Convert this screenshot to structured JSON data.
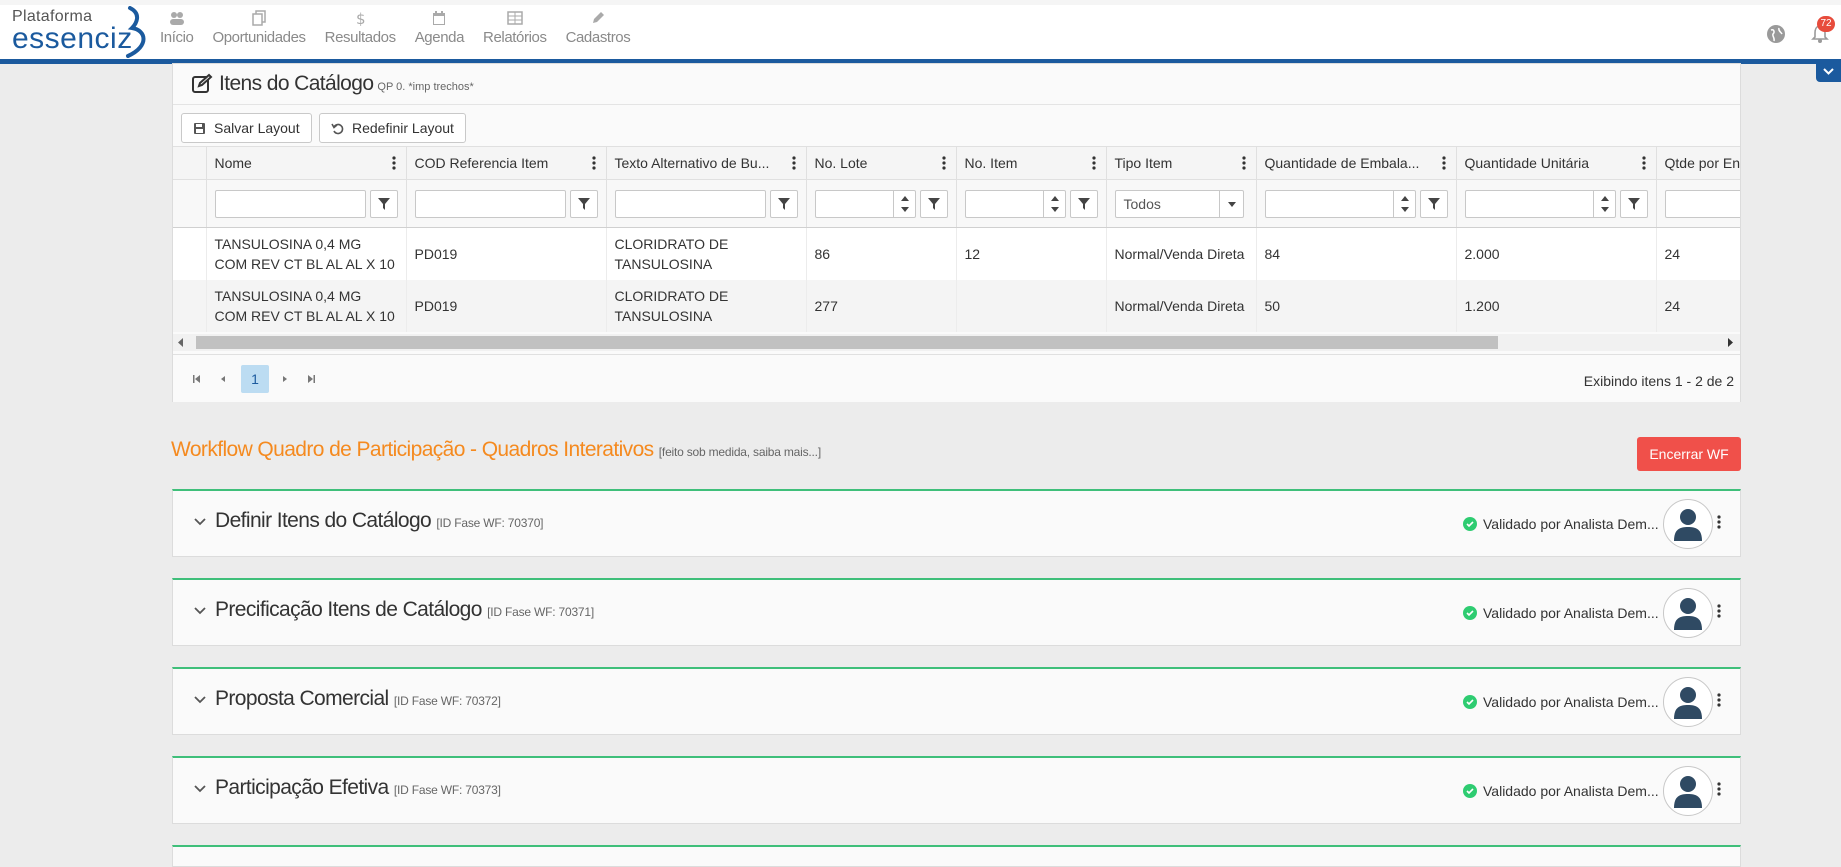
{
  "brand": {
    "line1": "Plataforma",
    "line2": "essenciz"
  },
  "nav": [
    {
      "label": "Início",
      "icon": "groups-icon"
    },
    {
      "label": "Oportunidades",
      "icon": "copy-icon"
    },
    {
      "label": "Resultados",
      "icon": "dollar-icon"
    },
    {
      "label": "Agenda",
      "icon": "calendar-icon"
    },
    {
      "label": "Relatórios",
      "icon": "table-icon"
    },
    {
      "label": "Cadastros",
      "icon": "pencil-icon"
    }
  ],
  "notifications": {
    "count": "72"
  },
  "catalog": {
    "title": "Itens do Catálogo",
    "subtitle": "QP 0. *imp trechos*",
    "save_layout": "Salvar Layout",
    "reset_layout": "Redefinir Layout",
    "columns": [
      "Nome",
      "COD Referencia Item",
      "Texto Alternativo de Bu...",
      "No. Lote",
      "No. Item",
      "Tipo Item",
      "Quantidade de Embala...",
      "Quantidade Unitária",
      "Qtde por En"
    ],
    "filter_select": "Todos",
    "rows": [
      {
        "nome": "TANSULOSINA 0,4 MG COM REV CT BL AL AL X 10",
        "cod": "PD019",
        "texto": "CLORIDRATO DE TANSULOSINA",
        "lote": "86",
        "item": "12",
        "tipo": "Normal/Venda Direta",
        "qtd_emb": "84",
        "qtd_unit": "2.000",
        "qtde_en": "24"
      },
      {
        "nome": "TANSULOSINA 0,4 MG COM REV CT BL AL AL X 10",
        "cod": "PD019",
        "texto": "CLORIDRATO DE TANSULOSINA",
        "lote": "277",
        "item": "",
        "tipo": "Normal/Venda Direta",
        "qtd_emb": "50",
        "qtd_unit": "1.200",
        "qtde_en": "24"
      }
    ],
    "pager": {
      "current": "1",
      "info": "Exibindo itens 1 - 2 de 2"
    }
  },
  "workflow": {
    "title": "Workflow Quadro de Participação - Quadros Interativos",
    "subtitle": "[feito sob medida, saiba mais...]",
    "end_button": "Encerrar WF",
    "phases": [
      {
        "name": "Definir Itens do Catálogo",
        "id": "[ID Fase WF: 70370]",
        "status": "Validado por Analista Dem..."
      },
      {
        "name": "Precificação Itens de Catálogo",
        "id": "[ID Fase WF: 70371]",
        "status": "Validado por Analista Dem..."
      },
      {
        "name": "Proposta Comercial",
        "id": "[ID Fase WF: 70372]",
        "status": "Validado por Analista Dem..."
      },
      {
        "name": "Participação Efetiva",
        "id": "[ID Fase WF: 70373]",
        "status": "Validado por Analista Dem..."
      }
    ]
  },
  "colors": {
    "brand_blue": "#1b5a9e",
    "accent_orange": "#f58a1f",
    "danger": "#f0504a",
    "success": "#2ecc71"
  }
}
